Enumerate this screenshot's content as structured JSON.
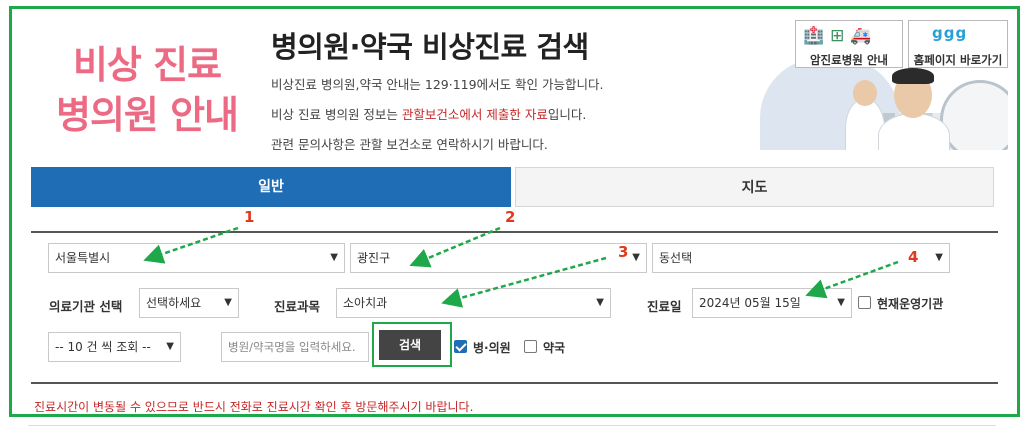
{
  "header": {
    "logo_line1": "비상 진료",
    "logo_line2": "병의원 안내",
    "title": "병의원·약국 비상진료 검색",
    "info1": "비상진료 병의원,약국 안내는 129·119에서도 확인 가능합니다.",
    "info2_pre": "비상 진료 병의원 정보는 ",
    "info2_highlight": "관할보건소에서 제출한 자료",
    "info2_post": "입니다.",
    "info3": "관련 문의사항은 관할 보건소로 연락하시기 바랍니다."
  },
  "banner": {
    "cancer_button": "암진료병원 안내",
    "homepage_button": "홈페이지 바로가기",
    "homepage_logo": "ggg"
  },
  "tabs": [
    {
      "label": "일반",
      "active": true
    },
    {
      "label": "지도",
      "active": false
    }
  ],
  "filters": {
    "city": "서울특별시",
    "district": "광진구",
    "dong": "동선택",
    "institution_label": "의료기관 선택",
    "institution_value": "선택하세요",
    "department_label": "진료과목",
    "department_value": "소아치과",
    "date_label": "진료일",
    "date_value": "2024년 05월 15일",
    "operating_label": "현재운영기관",
    "page_size": "-- 10 건 씩 조회 --",
    "name_placeholder": "병원/약국명을 입력하세요.",
    "search_button": "검색",
    "hospital_label": "병·의원",
    "pharmacy_label": "약국"
  },
  "annotations": [
    "1",
    "2",
    "3",
    "4"
  ],
  "notice": "진료시간이 변동될 수 있으므로 반드시 전화로 진료시간 확인 후 방문해주시기 바랍니다.",
  "colors": {
    "accent_blue": "#1e6db5",
    "highlight_green": "#1fa84a",
    "annotation_red": "#e03a1e",
    "logo_pink": "#ec6a83"
  }
}
